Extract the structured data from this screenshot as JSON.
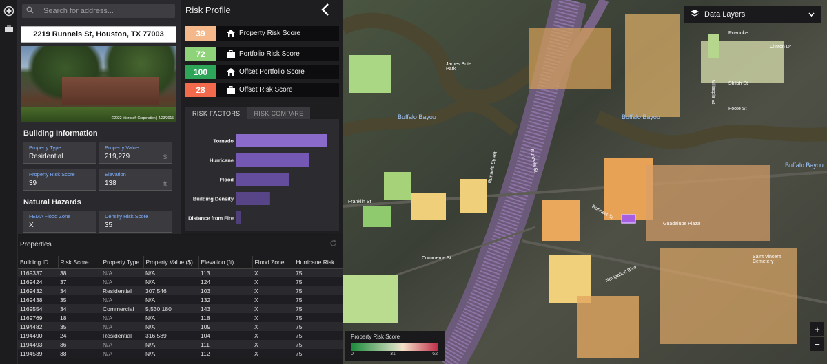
{
  "search": {
    "placeholder": "Search for address..."
  },
  "property": {
    "address": "2219 Runnels St, Houston, TX 77003",
    "photo_credit": "©2022 Microsoft Corporation | 4/23/2015"
  },
  "building_info": {
    "title": "Building Information",
    "fields": [
      {
        "label": "Property Type",
        "value": "Residential",
        "unit": ""
      },
      {
        "label": "Property Value",
        "value": "219,279",
        "unit": "$"
      },
      {
        "label": "Property Risk Score",
        "value": "39",
        "unit": ""
      },
      {
        "label": "Elevation",
        "value": "138",
        "unit": "ft"
      }
    ]
  },
  "natural_hazards": {
    "title": "Natural Hazards",
    "fields": [
      {
        "label": "FEMA Flood Zone",
        "value": "X"
      },
      {
        "label": "Density Risk Score",
        "value": "35"
      }
    ]
  },
  "risk_profile": {
    "title": "Risk Profile",
    "scores": [
      {
        "value": "39",
        "label": "Property Risk Score",
        "color": "#f5b88a",
        "icon": "home-icon"
      },
      {
        "value": "72",
        "label": "Portfolio Risk Score",
        "color": "#8ed27a",
        "icon": "briefcase-icon"
      },
      {
        "value": "100",
        "label": "Offset Portfolio Score",
        "color": "#2ea65a",
        "icon": "home-icon"
      },
      {
        "value": "28",
        "label": "Offset Risk Score",
        "color": "#f26a4b",
        "icon": "briefcase-icon"
      }
    ],
    "tabs": [
      "RISK FACTORS",
      "RISK COMPARE"
    ]
  },
  "chart_data": {
    "type": "bar",
    "orientation": "horizontal",
    "categories": [
      "Tornado",
      "Hurricane",
      "Flood",
      "Building Density",
      "Distance from Fire"
    ],
    "values": [
      100,
      80,
      58,
      37,
      5
    ],
    "colors": [
      "#8a6bcc",
      "#7458b4",
      "#654d9d",
      "#584587",
      "#4f3f7a"
    ]
  },
  "properties": {
    "title": "Properties",
    "columns": [
      "Building ID",
      "Risk Score",
      "Property Type",
      "Property Value ($)",
      "Elevation (ft)",
      "Flood Zone",
      "Hurricane Risk"
    ],
    "rows": [
      [
        "1169337",
        "38",
        "N/A",
        "N/A",
        "113",
        "X",
        "75"
      ],
      [
        "1169424",
        "37",
        "N/A",
        "N/A",
        "124",
        "X",
        "75"
      ],
      [
        "1169432",
        "34",
        "Residential",
        "307,546",
        "103",
        "X",
        "75"
      ],
      [
        "1169438",
        "35",
        "N/A",
        "N/A",
        "132",
        "X",
        "75"
      ],
      [
        "1169554",
        "34",
        "Commercial",
        "5,530,180",
        "143",
        "X",
        "75"
      ],
      [
        "1169769",
        "18",
        "N/A",
        "N/A",
        "118",
        "X",
        "75"
      ],
      [
        "1194482",
        "35",
        "N/A",
        "N/A",
        "109",
        "X",
        "75"
      ],
      [
        "1194490",
        "24",
        "Residential",
        "316,589",
        "104",
        "X",
        "75"
      ],
      [
        "1194493",
        "36",
        "N/A",
        "N/A",
        "111",
        "X",
        "75"
      ],
      [
        "1194539",
        "38",
        "N/A",
        "N/A",
        "112",
        "X",
        "75"
      ]
    ]
  },
  "map": {
    "data_layers_label": "Data Layers",
    "legend": {
      "title": "Property Risk Score",
      "min": "0",
      "mid": "31",
      "max": "62"
    },
    "labels": [
      "Buffalo Bayou",
      "Buffalo Bayou",
      "Buffalo Bayou",
      "Franklin St",
      "Commerce St",
      "Guadalupe Plaza",
      "Saint Vincent Cemetery",
      "Runnels St",
      "Navigation Blvd",
      "Roanoke",
      "Clinton Dr",
      "Foote St",
      "Shiloh St",
      "Gillespie St",
      "James Bute Park",
      "Runnels Street",
      "Runnels St"
    ],
    "zoom_in": "+",
    "zoom_out": "−"
  }
}
